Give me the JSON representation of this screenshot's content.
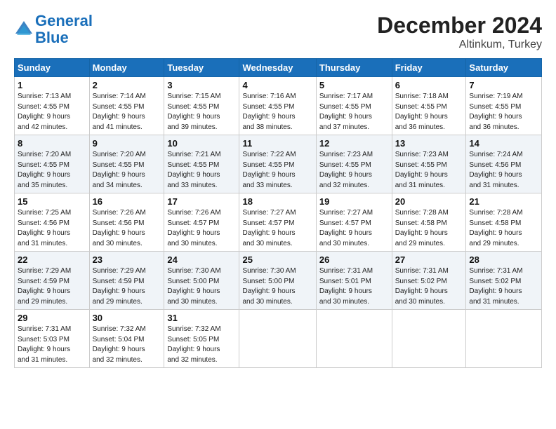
{
  "logo": {
    "line1": "General",
    "line2": "Blue"
  },
  "title": "December 2024",
  "subtitle": "Altinkum, Turkey",
  "days_of_week": [
    "Sunday",
    "Monday",
    "Tuesday",
    "Wednesday",
    "Thursday",
    "Friday",
    "Saturday"
  ],
  "weeks": [
    [
      {
        "day": "1",
        "info": "Sunrise: 7:13 AM\nSunset: 4:55 PM\nDaylight: 9 hours\nand 42 minutes."
      },
      {
        "day": "2",
        "info": "Sunrise: 7:14 AM\nSunset: 4:55 PM\nDaylight: 9 hours\nand 41 minutes."
      },
      {
        "day": "3",
        "info": "Sunrise: 7:15 AM\nSunset: 4:55 PM\nDaylight: 9 hours\nand 39 minutes."
      },
      {
        "day": "4",
        "info": "Sunrise: 7:16 AM\nSunset: 4:55 PM\nDaylight: 9 hours\nand 38 minutes."
      },
      {
        "day": "5",
        "info": "Sunrise: 7:17 AM\nSunset: 4:55 PM\nDaylight: 9 hours\nand 37 minutes."
      },
      {
        "day": "6",
        "info": "Sunrise: 7:18 AM\nSunset: 4:55 PM\nDaylight: 9 hours\nand 36 minutes."
      },
      {
        "day": "7",
        "info": "Sunrise: 7:19 AM\nSunset: 4:55 PM\nDaylight: 9 hours\nand 36 minutes."
      }
    ],
    [
      {
        "day": "8",
        "info": "Sunrise: 7:20 AM\nSunset: 4:55 PM\nDaylight: 9 hours\nand 35 minutes."
      },
      {
        "day": "9",
        "info": "Sunrise: 7:20 AM\nSunset: 4:55 PM\nDaylight: 9 hours\nand 34 minutes."
      },
      {
        "day": "10",
        "info": "Sunrise: 7:21 AM\nSunset: 4:55 PM\nDaylight: 9 hours\nand 33 minutes."
      },
      {
        "day": "11",
        "info": "Sunrise: 7:22 AM\nSunset: 4:55 PM\nDaylight: 9 hours\nand 33 minutes."
      },
      {
        "day": "12",
        "info": "Sunrise: 7:23 AM\nSunset: 4:55 PM\nDaylight: 9 hours\nand 32 minutes."
      },
      {
        "day": "13",
        "info": "Sunrise: 7:23 AM\nSunset: 4:55 PM\nDaylight: 9 hours\nand 31 minutes."
      },
      {
        "day": "14",
        "info": "Sunrise: 7:24 AM\nSunset: 4:56 PM\nDaylight: 9 hours\nand 31 minutes."
      }
    ],
    [
      {
        "day": "15",
        "info": "Sunrise: 7:25 AM\nSunset: 4:56 PM\nDaylight: 9 hours\nand 31 minutes."
      },
      {
        "day": "16",
        "info": "Sunrise: 7:26 AM\nSunset: 4:56 PM\nDaylight: 9 hours\nand 30 minutes."
      },
      {
        "day": "17",
        "info": "Sunrise: 7:26 AM\nSunset: 4:57 PM\nDaylight: 9 hours\nand 30 minutes."
      },
      {
        "day": "18",
        "info": "Sunrise: 7:27 AM\nSunset: 4:57 PM\nDaylight: 9 hours\nand 30 minutes."
      },
      {
        "day": "19",
        "info": "Sunrise: 7:27 AM\nSunset: 4:57 PM\nDaylight: 9 hours\nand 30 minutes."
      },
      {
        "day": "20",
        "info": "Sunrise: 7:28 AM\nSunset: 4:58 PM\nDaylight: 9 hours\nand 29 minutes."
      },
      {
        "day": "21",
        "info": "Sunrise: 7:28 AM\nSunset: 4:58 PM\nDaylight: 9 hours\nand 29 minutes."
      }
    ],
    [
      {
        "day": "22",
        "info": "Sunrise: 7:29 AM\nSunset: 4:59 PM\nDaylight: 9 hours\nand 29 minutes."
      },
      {
        "day": "23",
        "info": "Sunrise: 7:29 AM\nSunset: 4:59 PM\nDaylight: 9 hours\nand 29 minutes."
      },
      {
        "day": "24",
        "info": "Sunrise: 7:30 AM\nSunset: 5:00 PM\nDaylight: 9 hours\nand 30 minutes."
      },
      {
        "day": "25",
        "info": "Sunrise: 7:30 AM\nSunset: 5:00 PM\nDaylight: 9 hours\nand 30 minutes."
      },
      {
        "day": "26",
        "info": "Sunrise: 7:31 AM\nSunset: 5:01 PM\nDaylight: 9 hours\nand 30 minutes."
      },
      {
        "day": "27",
        "info": "Sunrise: 7:31 AM\nSunset: 5:02 PM\nDaylight: 9 hours\nand 30 minutes."
      },
      {
        "day": "28",
        "info": "Sunrise: 7:31 AM\nSunset: 5:02 PM\nDaylight: 9 hours\nand 31 minutes."
      }
    ],
    [
      {
        "day": "29",
        "info": "Sunrise: 7:31 AM\nSunset: 5:03 PM\nDaylight: 9 hours\nand 31 minutes."
      },
      {
        "day": "30",
        "info": "Sunrise: 7:32 AM\nSunset: 5:04 PM\nDaylight: 9 hours\nand 32 minutes."
      },
      {
        "day": "31",
        "info": "Sunrise: 7:32 AM\nSunset: 5:05 PM\nDaylight: 9 hours\nand 32 minutes."
      },
      {
        "day": "",
        "info": ""
      },
      {
        "day": "",
        "info": ""
      },
      {
        "day": "",
        "info": ""
      },
      {
        "day": "",
        "info": ""
      }
    ]
  ]
}
